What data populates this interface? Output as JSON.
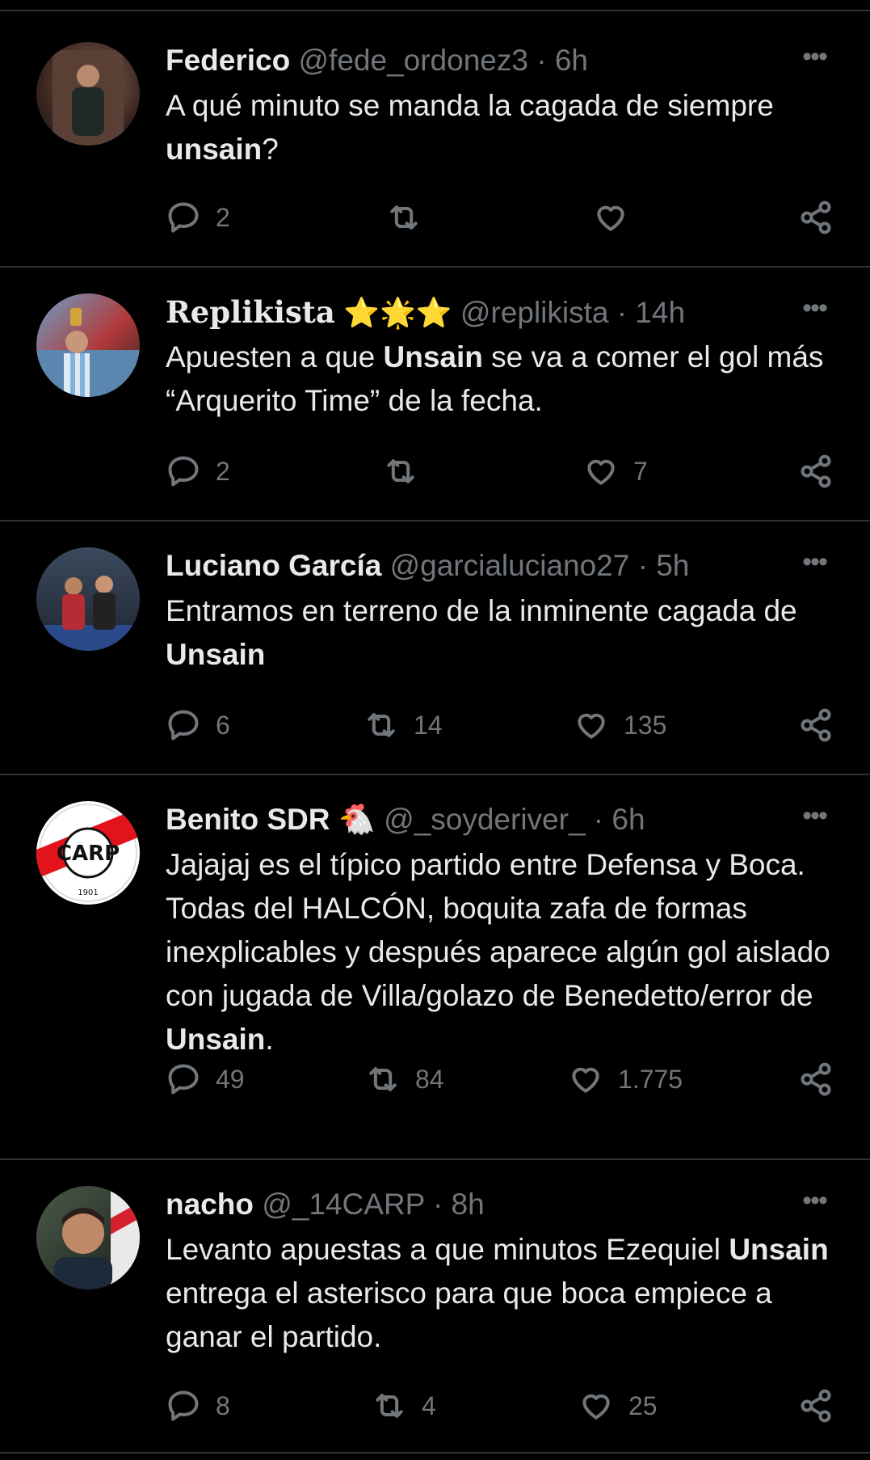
{
  "tweets": [
    {
      "name": "Federico",
      "meta": "@fede_ordonez3 · 6h",
      "body_html": "A qué minuto se manda la cagada de siempre <b>unsain</b>?",
      "replies": "2",
      "retweets": "",
      "likes": ""
    },
    {
      "name": "Replikista",
      "badges": "⭐🌟⭐",
      "meta": "@replikista · 14h",
      "body_html": "Apuesten a que <b>Unsain</b> se va a comer el gol más “Arquerito Time” de la fecha.",
      "replies": "2",
      "retweets": "",
      "likes": "7"
    },
    {
      "name": "Luciano García",
      "meta": "@garcialuciano27 · 5h",
      "body_html": "Entramos en terreno de la inminente cagada de <b>Unsain</b>",
      "replies": "6",
      "retweets": "14",
      "likes": "135"
    },
    {
      "name": "Benito SDR",
      "badges": "🐔",
      "meta": "@_soyderiver_ · 6h",
      "body_html": "Jajajaj es el típico partido entre Defensa y Boca. Todas del HALCÓN, boquita zafa de formas inexplicables y después aparece algún gol aislado con jugada de Villa/golazo de Benedetto/error de <b>Unsain</b>.",
      "replies": "49",
      "retweets": "84",
      "likes": "1.775"
    },
    {
      "name": "nacho",
      "meta": "@_14CARP · 8h",
      "body_html": "Levanto apuestas a que minutos Ezequiel <b>Unsain</b> entrega el asterisco para que boca empiece a ganar el partido.",
      "replies": "8",
      "retweets": "4",
      "likes": "25"
    }
  ],
  "avatar_badge": {
    "text": "CARP",
    "year": "1901"
  },
  "more_label": "•••",
  "colors": {
    "bg": "#000000",
    "text": "#e7e9ea",
    "muted": "#71767b",
    "divider": "#2f3336",
    "river_red": "#e3131b"
  }
}
